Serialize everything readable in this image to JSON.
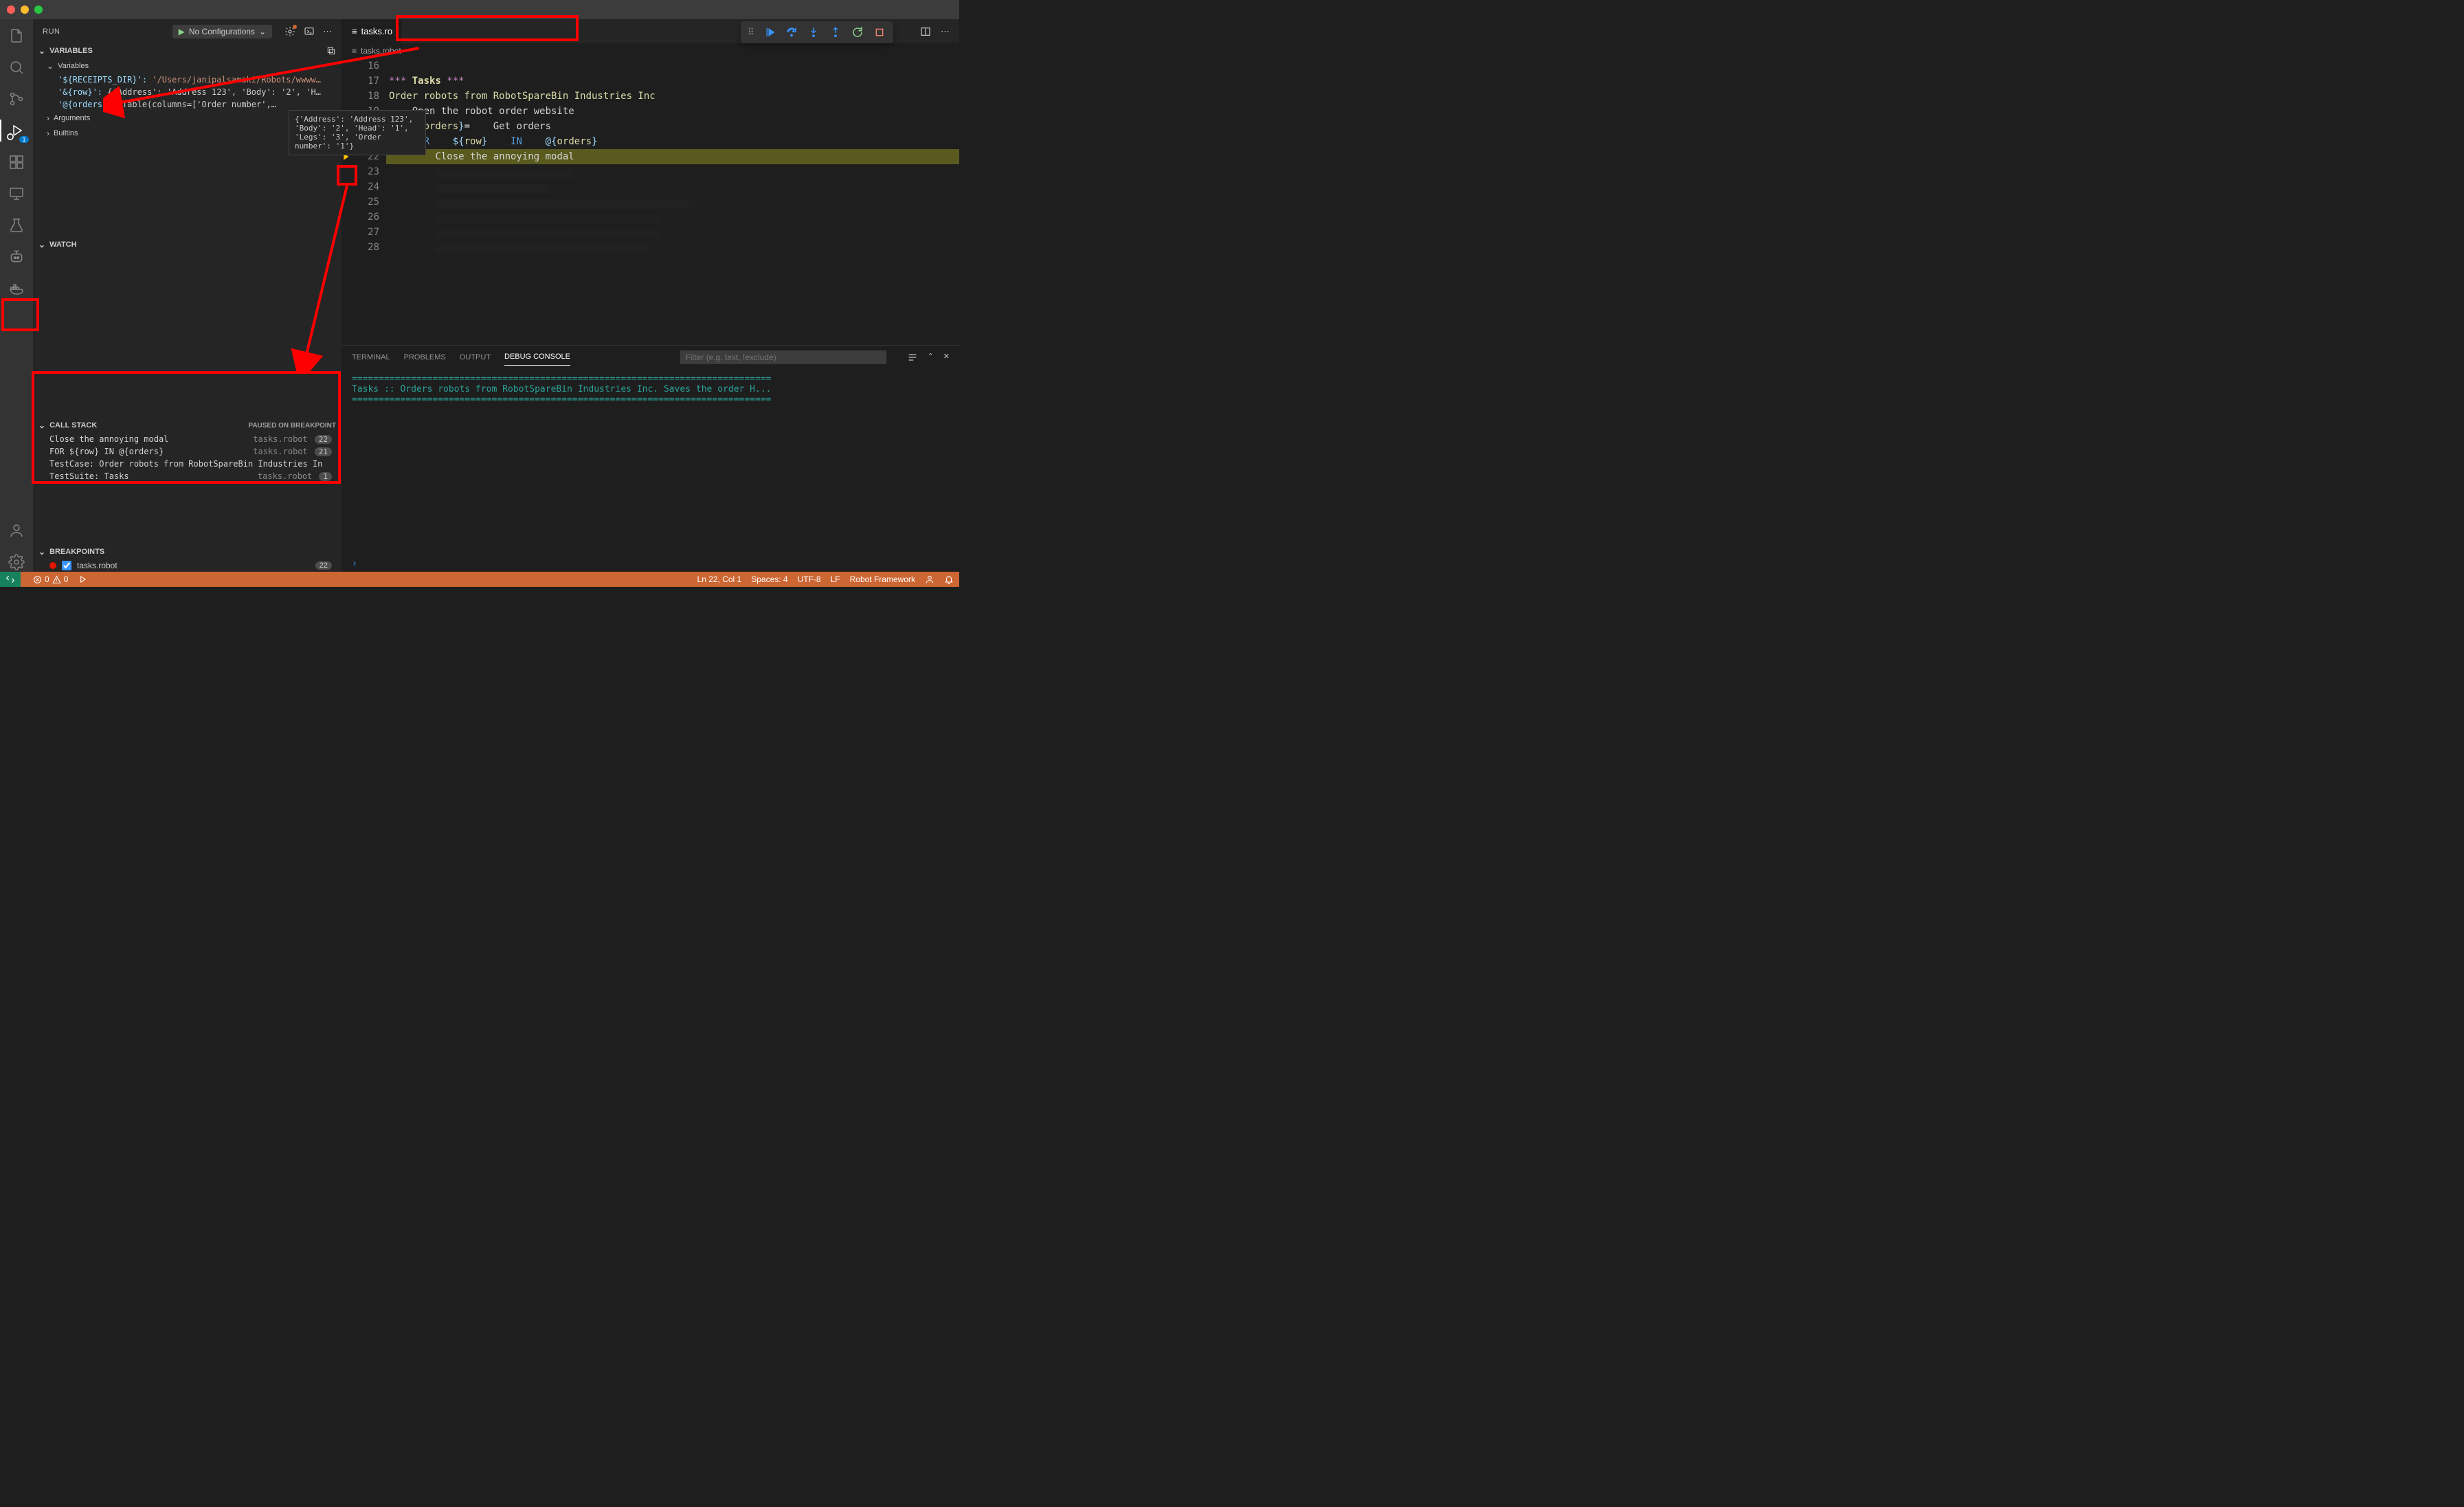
{
  "titlebar": {},
  "sidebar": {
    "run_label": "RUN",
    "config": "No Configurations",
    "sections": {
      "variables": "VARIABLES",
      "variables_sub": "Variables",
      "arguments": "Arguments",
      "builtins": "Builtins",
      "watch": "WATCH",
      "callstack": "CALL STACK",
      "callstack_status": "PAUSED ON BREAKPOINT",
      "breakpoints": "BREAKPOINTS"
    },
    "vars": [
      {
        "key": "'${RECEIPTS_DIR}':",
        "val": "'/Users/janipalsamaki/Robots/wwww…"
      },
      {
        "key": "'&{row}':",
        "val": "{'Address': 'Address 123', 'Body': '2', 'H…"
      },
      {
        "key": "'@{orders}':",
        "val": "Table(columns=['Order number',…"
      }
    ],
    "tooltip": "{'Address': 'Address 123', 'Body': '2', 'Head': '1', 'Legs': '3', 'Order number': '1'}",
    "callstack": [
      {
        "desc": "Close the annoying modal",
        "file": "tasks.robot",
        "ln": "22"
      },
      {
        "desc": "FOR    ${row}    IN    @{orders}",
        "file": "tasks.robot",
        "ln": "21"
      },
      {
        "desc": "TestCase: Order robots from RobotSpareBin Industries In",
        "file": "",
        "ln": ""
      },
      {
        "desc": "TestSuite: Tasks",
        "file": "tasks.robot",
        "ln": "1"
      }
    ],
    "breakpoints": [
      {
        "file": "tasks.robot",
        "ln": "22"
      }
    ]
  },
  "editor": {
    "tab": "tasks.ro",
    "breadcrumb": "tasks.robot",
    "lines": [
      {
        "n": "16",
        "html": ""
      },
      {
        "n": "17",
        "html": "<span class='tok-section'>*** </span><span class='tok-header'>Tasks</span><span class='tok-section'> ***</span>"
      },
      {
        "n": "18",
        "html": "<span class='tok-varname'>Order robots from RobotSpareBin Industries Inc</span>"
      },
      {
        "n": "19",
        "html": "    <span class='tok-text'>Open the robot order website</span>"
      },
      {
        "n": "20",
        "html": "    <span class='tok-var'>${</span><span class='tok-varname'>orders</span><span class='tok-var'>}</span><span class='tok-text'>=</span>    <span class='tok-text'>Get orders</span>"
      },
      {
        "n": "21",
        "html": "    <span class='tok-kw'>FOR</span>    <span class='tok-var'>${</span><span class='tok-varname'>row</span><span class='tok-var'>}</span>    <span class='tok-kw'>IN</span>    <span class='tok-var'>@{</span><span class='tok-varname'>orders</span><span class='tok-var'>}</span>"
      },
      {
        "n": "22",
        "html": "        <span class='tok-text'>Close the annoying modal</span>",
        "current": true
      },
      {
        "n": "23",
        "html": "        <span class='tok-text'>........................</span>",
        "blur": true
      },
      {
        "n": "24",
        "html": "        <span class='tok-text'>....................</span>",
        "blur": true
      },
      {
        "n": "25",
        "html": "        <span class='tok-text'>.............................................</span>",
        "blur": true
      },
      {
        "n": "26",
        "html": "        <span class='tok-text'>.......................................</span>",
        "blur": true
      },
      {
        "n": "27",
        "html": "        <span class='tok-text'>.......................................</span>",
        "blur": true
      },
      {
        "n": "28",
        "html": "        <span class='tok-text'>.....................................</span>",
        "blur": true
      }
    ]
  },
  "panel": {
    "tabs": {
      "terminal": "TERMINAL",
      "problems": "PROBLEMS",
      "output": "OUTPUT",
      "debug": "DEBUG CONSOLE"
    },
    "filter_placeholder": "Filter (e.g. text, !exclude)",
    "output_lines": [
      "==============================================================================",
      "Tasks :: Orders robots from RobotSpareBin Industries Inc. Saves the order H...",
      "=============================================================================="
    ]
  },
  "statusbar": {
    "errors": "0",
    "warnings": "0",
    "ln_col": "Ln 22, Col 1",
    "spaces": "Spaces: 4",
    "encoding": "UTF-8",
    "eol": "LF",
    "lang": "Robot Framework"
  }
}
